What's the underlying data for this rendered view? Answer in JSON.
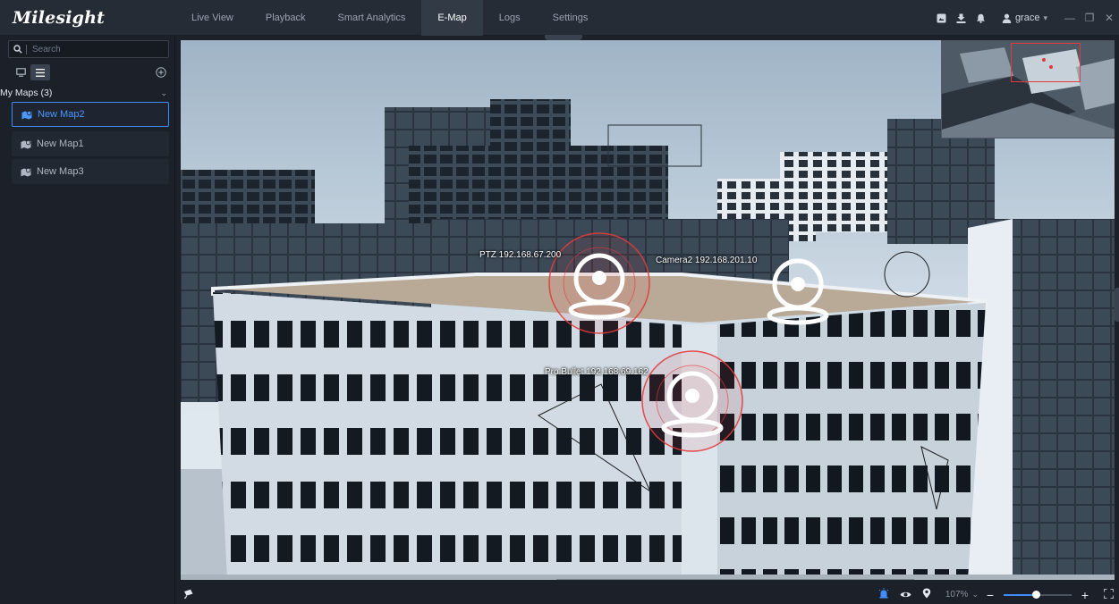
{
  "app": {
    "logo": "Milesight"
  },
  "nav": {
    "items": [
      "Live View",
      "Playback",
      "Smart Analytics",
      "E-Map",
      "Logs",
      "Settings"
    ],
    "active_index": 3
  },
  "user": {
    "name": "grace"
  },
  "icons": {
    "top_right": [
      "screenshot-icon",
      "download-icon",
      "notification-icon",
      "user-icon",
      "minimize-icon",
      "restore-icon",
      "close-icon"
    ],
    "bottom_left": "camera-icon",
    "bottom_right": [
      "alarm-icon",
      "visibility-icon",
      "location-pin-icon",
      "zoom-out-icon",
      "zoom-in-icon",
      "fullscreen-icon"
    ]
  },
  "sidebar": {
    "search_placeholder": "Search",
    "section_title": "My Maps (3)",
    "maps": [
      {
        "label": "New Map2",
        "active": true
      },
      {
        "label": "New Map1",
        "active": false
      },
      {
        "label": "New Map3",
        "active": false
      }
    ]
  },
  "map": {
    "cameras": [
      {
        "label": "PTZ 192.168.67.200",
        "alarm": true
      },
      {
        "label": "Camera2 192.168.201.10",
        "alarm": false
      },
      {
        "label": "Pro Bullet 192.168.69.162",
        "alarm": true
      }
    ]
  },
  "zoom": {
    "value": "107%",
    "level": 0.47
  },
  "colors": {
    "accent": "#3f8cff",
    "alarm": "#e23b3b",
    "topbar": "#262c36",
    "sidebar": "#1b2029"
  }
}
